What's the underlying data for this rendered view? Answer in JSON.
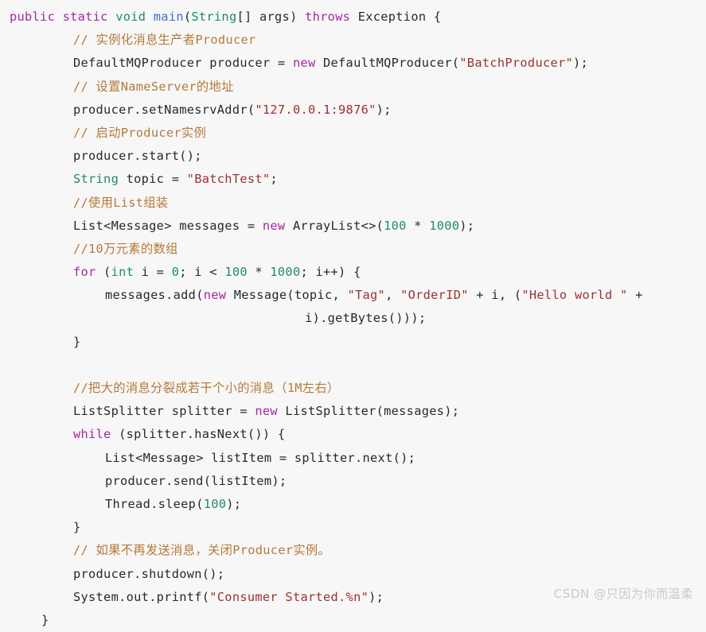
{
  "editor": {
    "language": "Java",
    "background_color": "#f7f7f7",
    "default_text_color": "#24292e",
    "theme_colors": {
      "keyword": "#a626a4",
      "type": "#1f8a70",
      "number": "#1f8a70",
      "function": "#3f6fd1",
      "string": "#a03030",
      "comment": "#b5793a",
      "plain": "#24292e"
    },
    "lines": [
      {
        "n": 1,
        "indent": 0,
        "text": "public static void main(String[] args) throws Exception {"
      },
      {
        "n": 2,
        "indent": 1,
        "text": "// 实例化消息生产者Producer"
      },
      {
        "n": 3,
        "indent": 1,
        "text": "DefaultMQProducer producer = new DefaultMQProducer(\"BatchProducer\");"
      },
      {
        "n": 4,
        "indent": 1,
        "text": "// 设置NameServer的地址"
      },
      {
        "n": 5,
        "indent": 1,
        "text": "producer.setNamesrvAddr(\"127.0.0.1:9876\");"
      },
      {
        "n": 6,
        "indent": 1,
        "text": "// 启动Producer实例"
      },
      {
        "n": 7,
        "indent": 1,
        "text": "producer.start();"
      },
      {
        "n": 8,
        "indent": 1,
        "text": "String topic = \"BatchTest\";"
      },
      {
        "n": 9,
        "indent": 1,
        "text": "//使用List组装"
      },
      {
        "n": 10,
        "indent": 1,
        "text": "List<Message> messages = new ArrayList<>(100 * 1000);"
      },
      {
        "n": 11,
        "indent": 1,
        "text": "//10万元素的数组"
      },
      {
        "n": 12,
        "indent": 1,
        "text": "for (int i = 0; i < 100 * 1000; i++) {"
      },
      {
        "n": 13,
        "indent": 2,
        "text": "messages.add(new Message(topic, \"Tag\", \"OrderID\" + i, (\"Hello world \" +"
      },
      {
        "n": 14,
        "indent": 0,
        "text": "                                       i).getBytes()));"
      },
      {
        "n": 15,
        "indent": 1,
        "text": "}"
      },
      {
        "n": 16,
        "indent": 0,
        "text": ""
      },
      {
        "n": 17,
        "indent": 1,
        "text": "//把大的消息分裂成若干个小的消息（1M左右）"
      },
      {
        "n": 18,
        "indent": 1,
        "text": "ListSplitter splitter = new ListSplitter(messages);"
      },
      {
        "n": 19,
        "indent": 1,
        "text": "while (splitter.hasNext()) {"
      },
      {
        "n": 20,
        "indent": 2,
        "text": "List<Message> listItem = splitter.next();"
      },
      {
        "n": 21,
        "indent": 2,
        "text": "producer.send(listItem);"
      },
      {
        "n": 22,
        "indent": 2,
        "text": "Thread.sleep(100);"
      },
      {
        "n": 23,
        "indent": 1,
        "text": "}"
      },
      {
        "n": 24,
        "indent": 1,
        "text": "// 如果不再发送消息，关闭Producer实例。"
      },
      {
        "n": 25,
        "indent": 1,
        "text": "producer.shutdown();"
      },
      {
        "n": 26,
        "indent": 1,
        "text": "System.out.printf(\"Consumer Started.%n\");"
      },
      {
        "n": 27,
        "indent": 0,
        "text": "    }"
      }
    ]
  },
  "watermark": {
    "text": "CSDN @只因为你而温柔"
  }
}
